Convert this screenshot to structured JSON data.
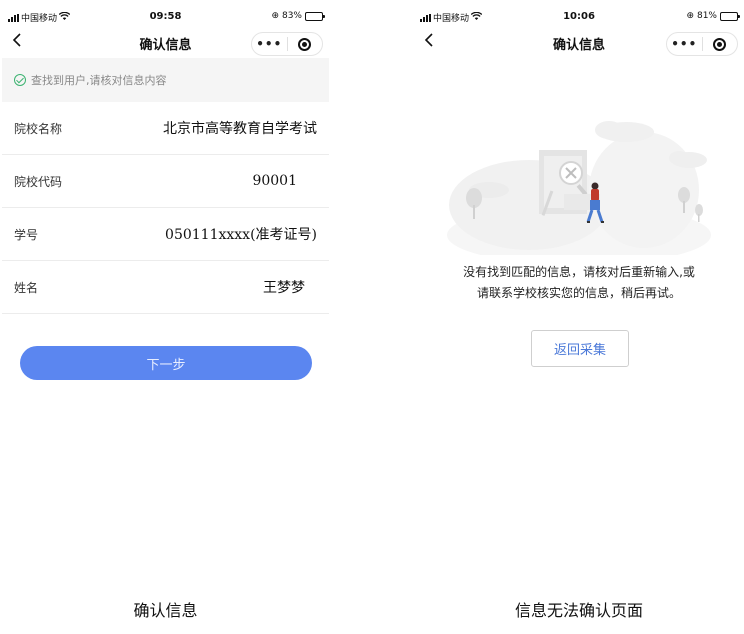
{
  "left_screen": {
    "status": {
      "carrier": "中国移动",
      "time": "09:58",
      "battery": "83%",
      "battery_level": 0.83
    },
    "nav": {
      "back_icon": "chevron-left-icon",
      "title": "确认信息",
      "more": "•••"
    },
    "notice": "查找到用户,请核对信息内容",
    "fields": [
      {
        "label": "院校名称",
        "value": "北京市高等教育自学考试"
      },
      {
        "label": "院校代码",
        "value": "90001"
      },
      {
        "label": "学号",
        "value": "050111xxxx(准考证号)"
      },
      {
        "label": "姓名",
        "value": "王梦梦"
      }
    ],
    "next_button": "下一步",
    "accent_color": "#5b86f0"
  },
  "right_screen": {
    "status": {
      "carrier": "中国移动",
      "time": "10:06",
      "battery": "81%",
      "battery_level": 0.81
    },
    "nav": {
      "back_icon": "chevron-left-icon",
      "title": "确认信息",
      "more": "•••"
    },
    "message_line1": "没有找到匹配的信息，请核对后重新输入,或",
    "message_line2": "请联系学校核实您的信息，稍后再试。",
    "return_button": "返回采集",
    "accent_color": "#4a78d8"
  },
  "captions": {
    "left": "确认信息",
    "right": "信息无法确认页面"
  }
}
